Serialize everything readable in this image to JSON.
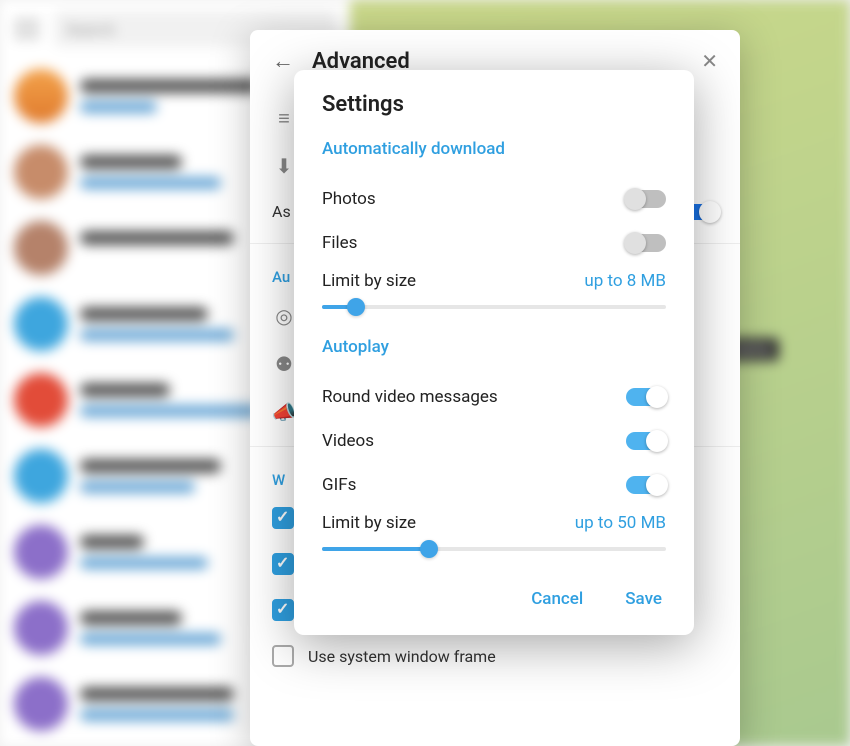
{
  "search": {
    "placeholder": "Search"
  },
  "tooltip": {
    "text": "saging"
  },
  "advanced": {
    "title": "Advanced",
    "section_automatic": "Au",
    "section_w": "W",
    "ask_label": "As",
    "use_system_frame": "Use system window frame"
  },
  "settings": {
    "title": "Settings",
    "sections": {
      "auto_download": {
        "header": "Automatically download",
        "photos": {
          "label": "Photos",
          "on": false
        },
        "files": {
          "label": "Files",
          "on": false
        },
        "limit": {
          "label": "Limit by size",
          "value": "up to 8 MB",
          "percent": 10
        }
      },
      "autoplay": {
        "header": "Autoplay",
        "round_video": {
          "label": "Round video messages",
          "on": true
        },
        "videos": {
          "label": "Videos",
          "on": true
        },
        "gifs": {
          "label": "GIFs",
          "on": true
        },
        "limit": {
          "label": "Limit by size",
          "value": "up to 50 MB",
          "percent": 31
        }
      }
    },
    "buttons": {
      "cancel": "Cancel",
      "save": "Save"
    }
  }
}
